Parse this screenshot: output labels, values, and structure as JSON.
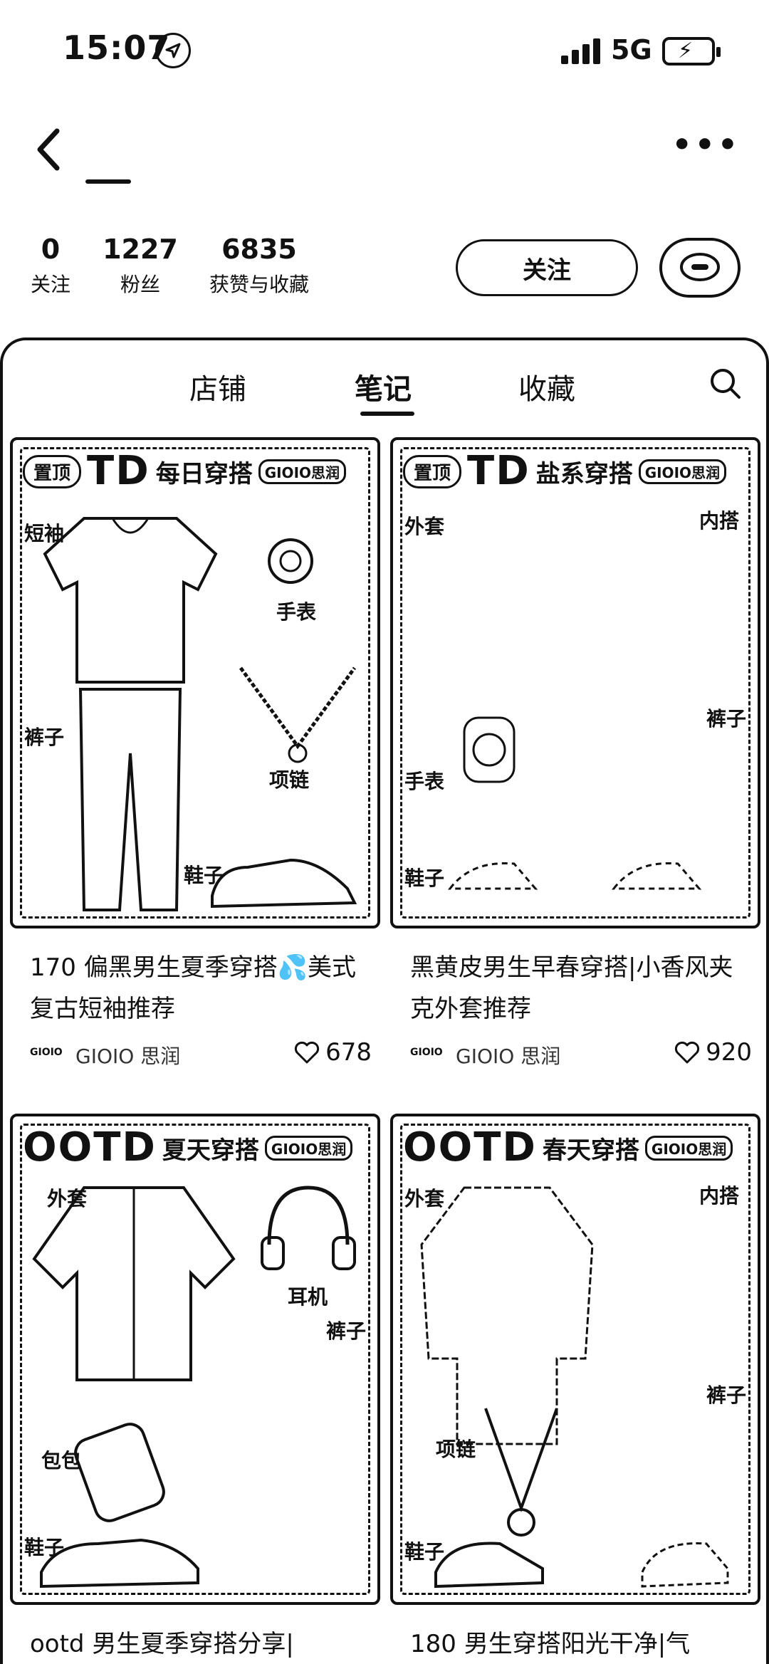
{
  "status_bar": {
    "time": "15:07",
    "network": "5G"
  },
  "stats": [
    {
      "value": "0",
      "label": "关注"
    },
    {
      "value": "1227",
      "label": "粉丝"
    },
    {
      "value": "6835",
      "label": "获赞与收藏"
    }
  ],
  "follow_button": "关注",
  "tabs": [
    "店铺",
    "笔记",
    "收藏"
  ],
  "cards": [
    {
      "pin": "置顶",
      "big": "TD",
      "heading": "每日穿搭",
      "brand_tag": "GIOIO思润",
      "labels": [
        "短袖",
        "手表",
        "裤子",
        "项链",
        "鞋子"
      ],
      "title": "170 偏黑男生夏季穿搭💦美式复古短袖推荐",
      "logo": "GIOIO",
      "author": "GIOIO 思润",
      "likes": "678"
    },
    {
      "pin": "置顶",
      "big": "TD",
      "heading": "盐系穿搭",
      "brand_tag": "GIOIO思润",
      "labels": [
        "外套",
        "内搭",
        "裤子",
        "手表",
        "鞋子"
      ],
      "title": "黑黄皮男生早春穿搭|小香风夹克外套推荐",
      "logo": "GIOIO",
      "author": "GIOIO 思润",
      "likes": "920"
    },
    {
      "pin": "",
      "big": "OOTD",
      "heading": "夏天穿搭",
      "brand_tag": "GIOIO思润",
      "labels": [
        "外套",
        "耳机",
        "裤子",
        "包包",
        "鞋子"
      ],
      "title": "ootd 男生夏季穿搭分享|",
      "logo": "",
      "author": "",
      "likes": ""
    },
    {
      "pin": "",
      "big": "OOTD",
      "heading": "春天穿搭",
      "brand_tag": "GIOIO思润",
      "labels": [
        "外套",
        "内搭",
        "裤子",
        "项链",
        "鞋子"
      ],
      "title": "180 男生穿搭阳光干净|气",
      "logo": "",
      "author": "",
      "likes": ""
    }
  ]
}
